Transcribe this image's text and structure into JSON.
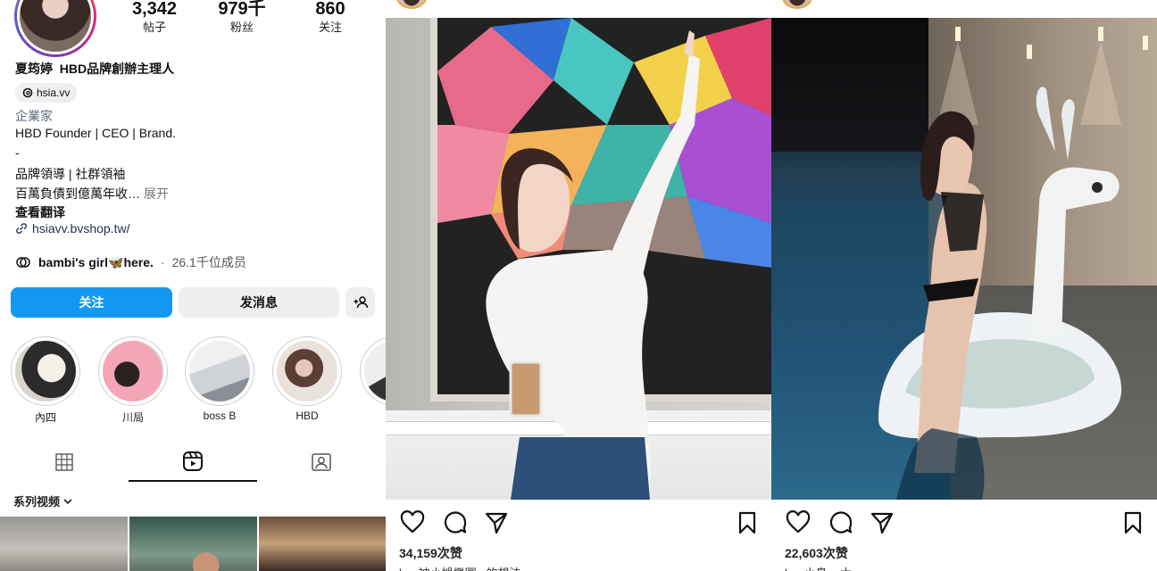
{
  "profile": {
    "stats": [
      {
        "value": "3,342",
        "label": "帖子"
      },
      {
        "value": "979千",
        "label": "粉丝"
      },
      {
        "value": "860",
        "label": "关注"
      }
    ],
    "name": "夏筠婷",
    "headline": "HBD品牌創辦主理人",
    "threads_handle": "hsia.vv",
    "category": "企業家",
    "bio": [
      "HBD Founder | CEO | Brand.",
      "-",
      "品牌領導 | 社群領袖",
      "百萬負債到億萬年收…"
    ],
    "bio_more": "展开",
    "translate": "查看翻译",
    "link": "hsiavv.bvshop.tw/",
    "threads_row": {
      "name": "bambi's girl🦋here.",
      "separator": "·",
      "count": "26.1千位成员"
    },
    "buttons": {
      "follow": "关注",
      "message": "发消息"
    },
    "highlights": [
      {
        "label": "內四"
      },
      {
        "label": "川局"
      },
      {
        "label": "boss B"
      },
      {
        "label": "HBD"
      },
      {
        "label": "HB"
      }
    ],
    "series_label": "系列视频"
  },
  "posts": [
    {
      "likes": "34,159次赞",
      "caption_peek": "h... 被小娛樂圈...的想法"
    },
    {
      "likes": "22,603次赞",
      "caption_peek": "h... 小鳥... 大 ..."
    }
  ],
  "colors": {
    "follow_button": "#1497f3",
    "secondary_button": "#efefef",
    "text_primary": "#111111",
    "category_text": "#5a6a80"
  },
  "icons": {
    "threads": "threads-icon",
    "link": "link-icon",
    "add_user": "add-user-icon",
    "grid": "grid-icon",
    "reels": "reels-icon",
    "tagged": "tagged-icon",
    "like": "heart-icon",
    "comment": "comment-icon",
    "share": "share-icon",
    "save": "bookmark-icon"
  }
}
